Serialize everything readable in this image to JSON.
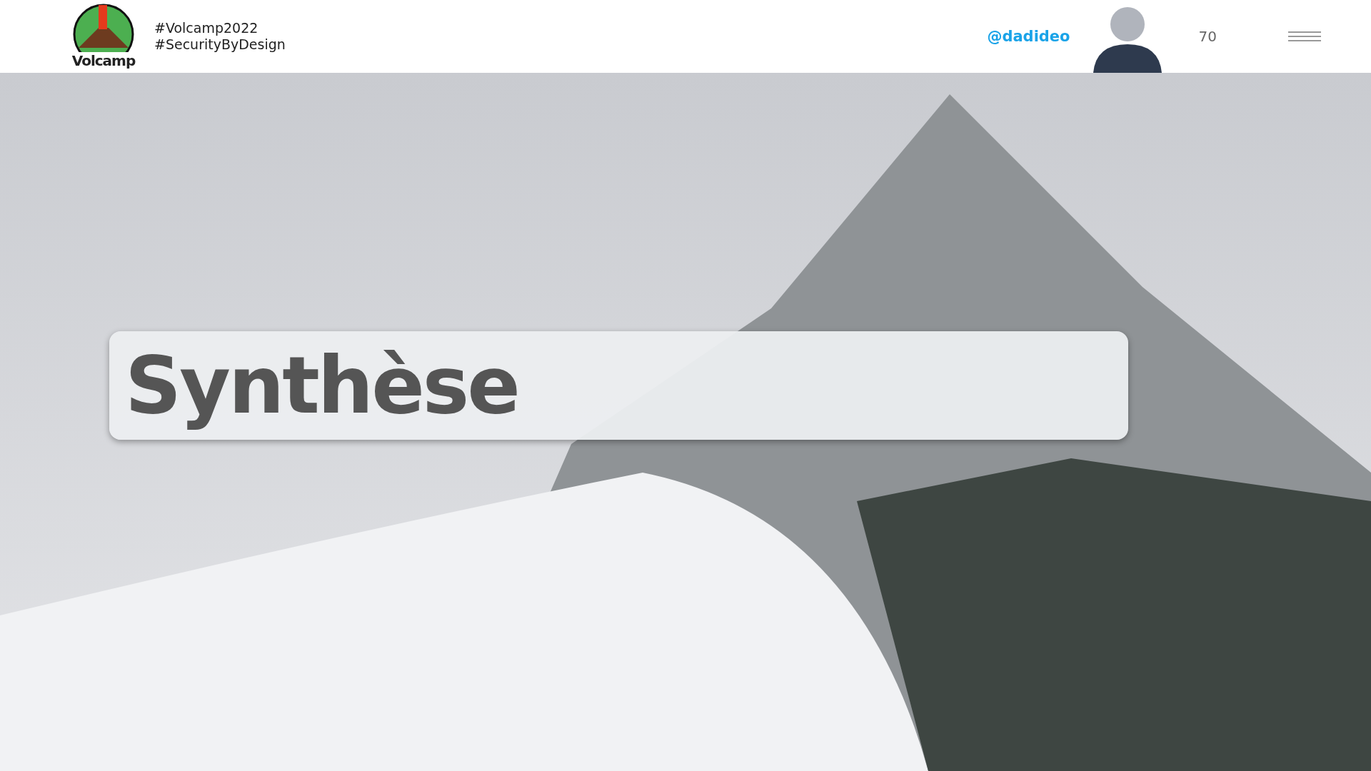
{
  "header": {
    "logo_text": "Volcamp",
    "hashtags": [
      "#Volcamp2022",
      "#SecurityByDesign"
    ],
    "handle": "@dadideo",
    "slide_number": "70"
  },
  "slide": {
    "title": "Synthèse"
  }
}
